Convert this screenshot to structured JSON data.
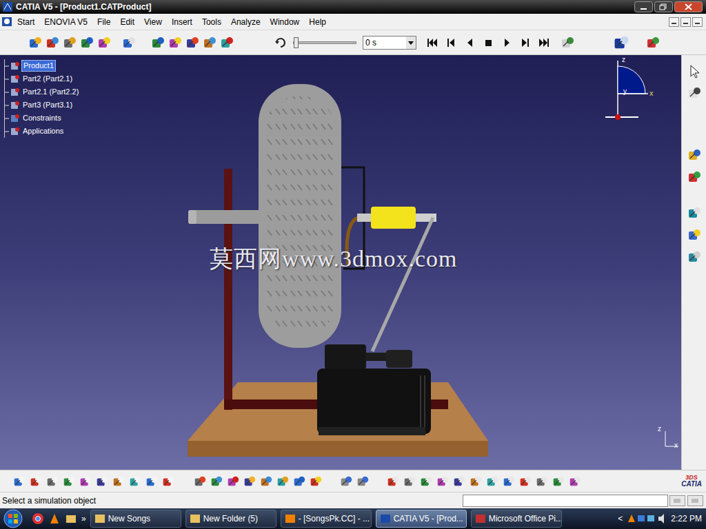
{
  "window": {
    "title": "CATIA V5 - [Product1.CATProduct]"
  },
  "menu": [
    "Start",
    "ENOVIA V5",
    "File",
    "Edit",
    "View",
    "Insert",
    "Tools",
    "Analyze",
    "Window",
    "Help"
  ],
  "simulation": {
    "time": "0 s",
    "level": 0
  },
  "tree": [
    {
      "label": "Product1",
      "selected": true
    },
    {
      "label": "Part2 (Part2.1)",
      "selected": false
    },
    {
      "label": "Part2.1 (Part2.2)",
      "selected": false
    },
    {
      "label": "Part3 (Part3.1)",
      "selected": false
    },
    {
      "label": "Constraints",
      "selected": false
    },
    {
      "label": "Applications",
      "selected": false
    }
  ],
  "compass": {
    "z": "z",
    "y": "y",
    "x": "x"
  },
  "axis": {
    "z": "z",
    "x": "x"
  },
  "watermark": "莫西网www.3dmox.com",
  "logo": {
    "brand": "3DS",
    "name": "CATIA"
  },
  "status_bar": {
    "text": "Select a simulation object"
  },
  "taskbar": {
    "overflow": "»",
    "items": [
      {
        "label": "New Songs",
        "selected": false
      },
      {
        "label": "New Folder (5)",
        "selected": false
      },
      {
        "label": "- [SongsPk.CC] - ...",
        "selected": false
      },
      {
        "label": "CATIA V5 - [Prod...",
        "selected": true
      },
      {
        "label": "Microsoft Office Pi...",
        "selected": false
      }
    ],
    "tray_arrow": "<",
    "clock": "2:22 PM"
  }
}
